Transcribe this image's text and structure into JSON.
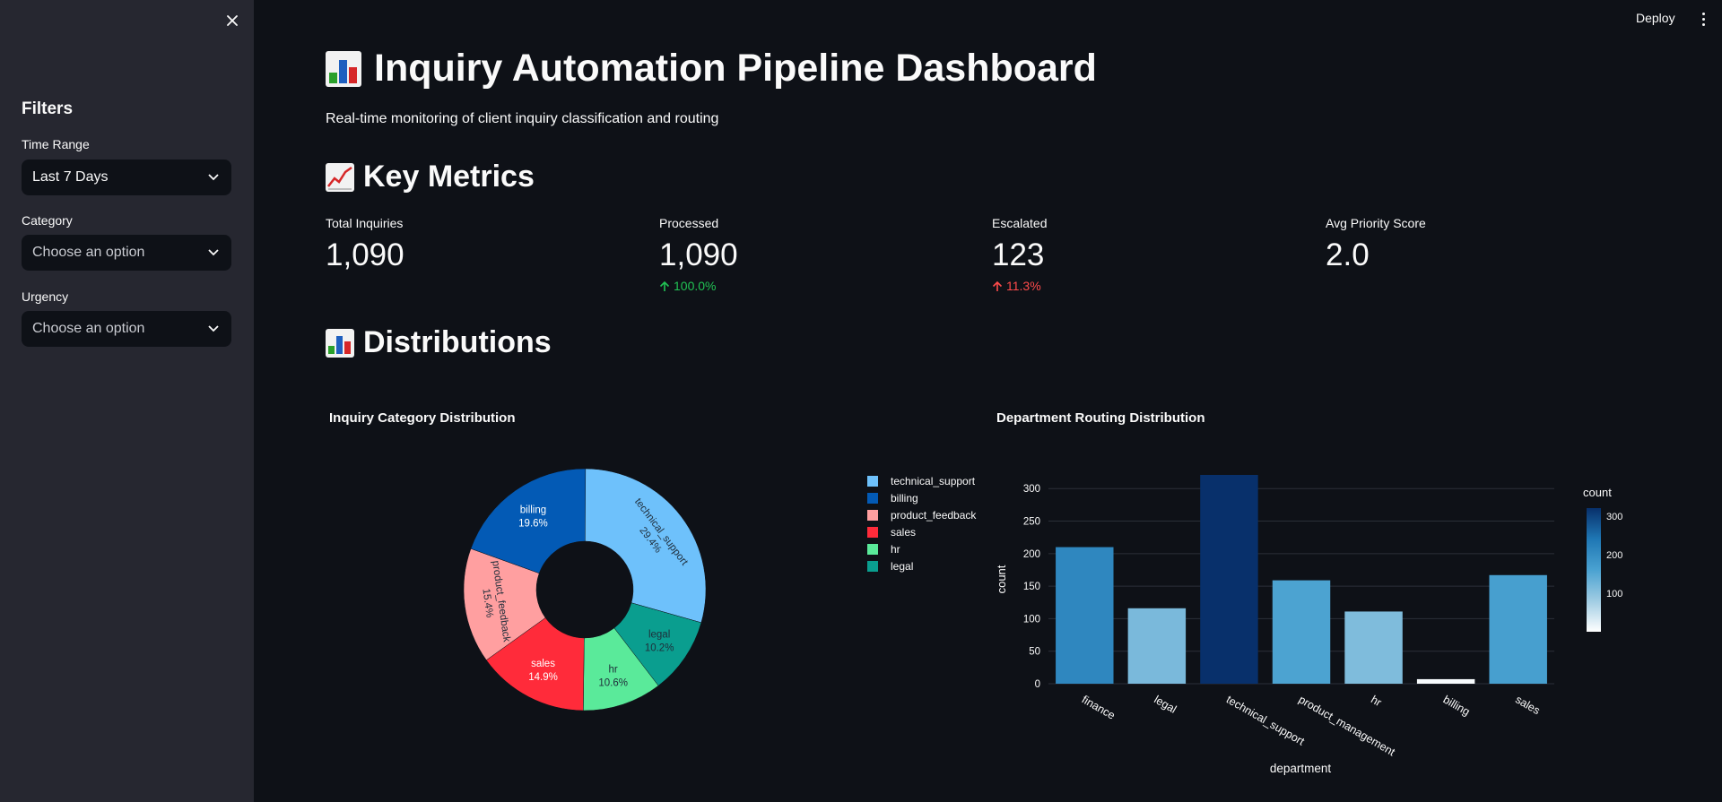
{
  "sidebar": {
    "title": "Filters",
    "filters": [
      {
        "label": "Time Range",
        "value": "Last 7 Days"
      },
      {
        "label": "Category",
        "placeholder": "Choose an option"
      },
      {
        "label": "Urgency",
        "placeholder": "Choose an option"
      }
    ]
  },
  "header": {
    "deploy_label": "Deploy"
  },
  "main": {
    "title": "Inquiry Automation Pipeline Dashboard",
    "subtitle": "Real-time monitoring of client inquiry classification and routing",
    "sections": {
      "metrics": "Key Metrics",
      "distributions": "Distributions"
    },
    "metrics": [
      {
        "label": "Total Inquiries",
        "value": "1,090"
      },
      {
        "label": "Processed",
        "value": "1,090",
        "delta": "100.0%",
        "delta_color": "#21c354"
      },
      {
        "label": "Escalated",
        "value": "123",
        "delta": "11.3%",
        "delta_color": "#ff4b4b"
      },
      {
        "label": "Avg Priority Score",
        "value": "2.0"
      }
    ]
  },
  "chart_data": [
    {
      "type": "pie",
      "hole": true,
      "title": "Inquiry Category Distribution",
      "slices": [
        {
          "label": "technical_support",
          "percent": 29.4,
          "color": "#6ec1fb"
        },
        {
          "label": "legal",
          "percent": 10.2,
          "color": "#0a9e8f"
        },
        {
          "label": "hr",
          "percent": 10.6,
          "color": "#5aea9a"
        },
        {
          "label": "sales",
          "percent": 14.9,
          "color": "#ff2b3a"
        },
        {
          "label": "product_feedback",
          "percent": 15.4,
          "color": "#ff9fa0"
        },
        {
          "label": "billing",
          "percent": 19.6,
          "color": "#035ab5"
        }
      ],
      "legend": [
        "technical_support",
        "billing",
        "product_feedback",
        "sales",
        "hr",
        "legal"
      ],
      "legend_position": "right"
    },
    {
      "type": "bar",
      "title": "Department Routing Distribution",
      "categories": [
        "finance",
        "legal",
        "technical_support",
        "product_management",
        "hr",
        "billing",
        "sales"
      ],
      "values": [
        210,
        116,
        321,
        159,
        111,
        7,
        167
      ],
      "xlabel": "department",
      "ylabel": "count",
      "ylim": [
        0,
        321
      ],
      "yticks": [
        0,
        50,
        100,
        150,
        200,
        250,
        300
      ],
      "colorbar": {
        "title": "count",
        "ticks": [
          100,
          200,
          300
        ],
        "colorscale": [
          "#ffffff",
          "#a0cce3",
          "#4aa2d1",
          "#1f77b4",
          "#08306b"
        ]
      },
      "grid": true
    }
  ]
}
